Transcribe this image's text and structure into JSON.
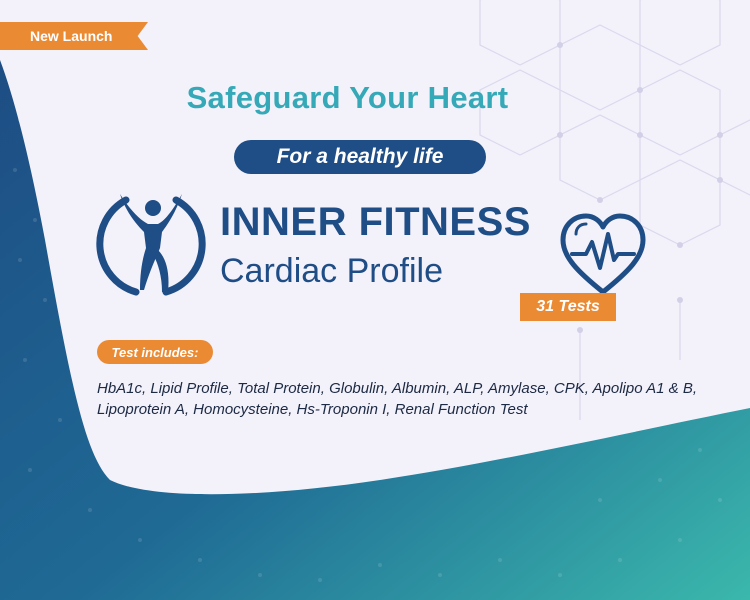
{
  "ribbon": {
    "label": "New Launch"
  },
  "headline": "Safeguard Your Heart",
  "tagline": "For a healthy life",
  "brand": {
    "name": "INNER FITNESS",
    "product": "Cardiac Profile",
    "logo_icon": "fitness-figure-icon"
  },
  "badge": {
    "tests_count": "31 Tests",
    "heart_icon": "heart-pulse-icon"
  },
  "includes": {
    "label": "Test includes:",
    "list": "HbA1c, Lipid Profile, Total Protein, Globulin, Albumin, ALP, Amylase, CPK, Apolipo A1 & B, Lipoprotein A, Homocysteine, Hs-Troponin I, Renal Function Test"
  },
  "colors": {
    "navy": "#1f4d86",
    "teal": "#35a9b7",
    "orange": "#ea8b34",
    "panel": "#f3f1fa"
  }
}
